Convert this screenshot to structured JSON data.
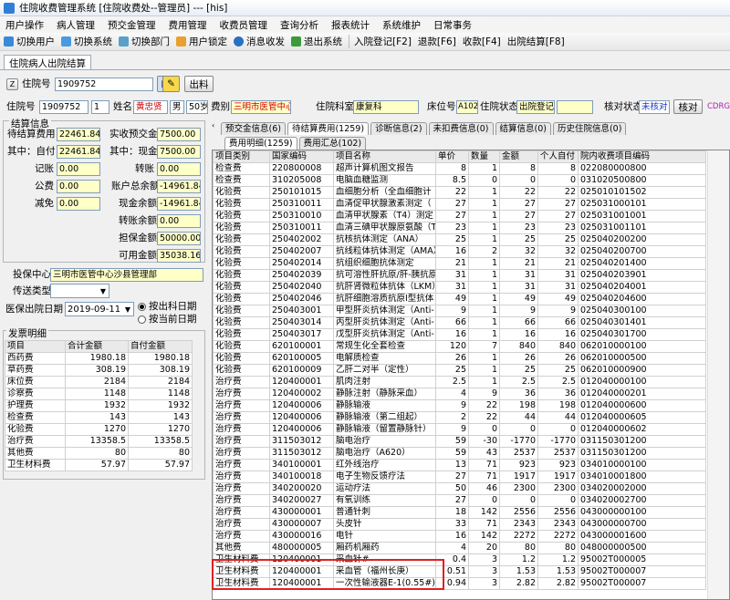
{
  "title": "住院收费管理系统 [住院收费处--管理员] --- [his]",
  "menu": [
    "用户操作",
    "病人管理",
    "预交金管理",
    "费用管理",
    "收费员管理",
    "查询分析",
    "报表统计",
    "系统维护",
    "日常事务"
  ],
  "toolbar": [
    "切换用户",
    "切换系统",
    "切换部门",
    "用户锁定",
    "消息收发",
    "退出系统",
    "入院登记[F2]",
    "退款[F6]",
    "收款[F4]",
    "出院结算[F8]"
  ],
  "doc_tab": "住院病人出院结算",
  "search": {
    "label": "住院号",
    "value": "1909752",
    "btn_print": "出料"
  },
  "patient": {
    "id": "1909752",
    "seq": "1",
    "name_label": "姓名",
    "name": "黄忠贤",
    "sex": "男",
    "age": "50岁",
    "cat_label": "费别",
    "cat": "三明市医管中心",
    "dept_label": "住院科室",
    "dept": "康复科",
    "bed_label": "床位号",
    "bed": "A1028",
    "status_label": "住院状态",
    "status": "出院登记",
    "audit_label": "核对状态",
    "audit": "未核对",
    "audit_btn": "核对",
    "cdrg": "CDRG分"
  },
  "settle": {
    "legend": "结算信息",
    "total_label": "待结算费用",
    "total": "22461.84",
    "prepay_label": "实收预交金",
    "prepay": "7500.00",
    "self_label": "其中：自付",
    "self": "22461.84",
    "cash_label": "其中：现金",
    "cash": "7500.00",
    "credit_label": "记账",
    "credit": "0.00",
    "transfer_label": "转账",
    "transfer": "0.00",
    "pub_label": "公费",
    "pub": "0.00",
    "balance_label": "账户总余额",
    "balance": "-14961.84",
    "reduce_label": "减免",
    "reduce": "0.00",
    "cash_bal_label": "现金余额",
    "cash_bal": "-14961.84",
    "tr_bal_label": "转账余额",
    "tr_bal": "0.00",
    "guar_label": "担保金额",
    "guar": "50000.00",
    "avail_label": "可用金额",
    "avail": "35038.16"
  },
  "insure": {
    "label": "投保中心",
    "value": "三明市医管中心沙县管理部",
    "type_label": "传送类型",
    "type": ""
  },
  "discharge": {
    "label": "医保出院日期",
    "date": "2019-09-11",
    "opt1": "按出科日期",
    "opt2": "按当前日期"
  },
  "invoice": {
    "legend": "发票明细",
    "headers": [
      "项目",
      "合计金额",
      "自付金额"
    ],
    "rows": [
      [
        "西药费",
        "1980.18",
        "1980.18"
      ],
      [
        "草药费",
        "308.19",
        "308.19"
      ],
      [
        "床位费",
        "2184",
        "2184"
      ],
      [
        "诊察费",
        "1148",
        "1148"
      ],
      [
        "护理费",
        "1932",
        "1932"
      ],
      [
        "检查费",
        "143",
        "143"
      ],
      [
        "化验费",
        "1270",
        "1270"
      ],
      [
        "治疗费",
        "13358.5",
        "13358.5"
      ],
      [
        "其他费",
        "80",
        "80"
      ],
      [
        "卫生材料费",
        "57.97",
        "57.97"
      ]
    ]
  },
  "tabs_top": [
    "预交金信息(6)",
    "待结算费用(1259)",
    "诊断信息(2)",
    "未扣费信息(0)",
    "结算信息(0)",
    "历史住院信息(0)"
  ],
  "tabs_sub": [
    "费用明细(1259)",
    "费用汇总(102)"
  ],
  "detail": {
    "headers": [
      "项目类别",
      "国家编码",
      "项目名称",
      "单价",
      "数量",
      "金额",
      "个人自付",
      "院内收费项目编码"
    ],
    "rows": [
      [
        "检查费",
        "220800008",
        "超声计算机图文报告",
        "8",
        "1",
        "8",
        "8",
        "022080000800"
      ],
      [
        "检查费",
        "310205008",
        "电脑血糖监测",
        "8.5",
        "0",
        "0",
        "0",
        "031020500800"
      ],
      [
        "化验费",
        "250101015",
        "血细胞分析（全血细胞计",
        "22",
        "1",
        "22",
        "22",
        "025010101502"
      ],
      [
        "化验费",
        "250310011",
        "血清促甲状腺激素测定（",
        "27",
        "1",
        "27",
        "27",
        "025031000101"
      ],
      [
        "化验费",
        "250310010",
        "血清甲状腺素（T4）测定",
        "27",
        "1",
        "27",
        "27",
        "025031001001"
      ],
      [
        "化验费",
        "250310011",
        "血清三碘甲状腺原氨酸（T3",
        "23",
        "1",
        "23",
        "23",
        "025031001101"
      ],
      [
        "化验费",
        "250402002",
        "抗核抗体测定（ANA）",
        "25",
        "1",
        "25",
        "25",
        "025040200200"
      ],
      [
        "化验费",
        "250402007",
        "抗线粒体抗体测定（AMA）",
        "16",
        "2",
        "32",
        "32",
        "025040200700"
      ],
      [
        "化验费",
        "250402014",
        "抗组织细胞抗体测定",
        "21",
        "1",
        "21",
        "21",
        "025040201400"
      ],
      [
        "化验费",
        "250402039",
        "抗可溶性肝抗原/肝-胰抗原",
        "31",
        "1",
        "31",
        "31",
        "025040203901"
      ],
      [
        "化验费",
        "250402040",
        "抗肝肾微粒体抗体（LKM）",
        "31",
        "1",
        "31",
        "31",
        "025040204001"
      ],
      [
        "化验费",
        "250402046",
        "抗肝细胞溶质抗原I型抗体",
        "49",
        "1",
        "49",
        "49",
        "025040204600"
      ],
      [
        "化验费",
        "250403001",
        "甲型肝炎抗体测定（Anti-",
        "9",
        "1",
        "9",
        "9",
        "025040300100"
      ],
      [
        "化验费",
        "250403014",
        "丙型肝炎抗体测定（Anti-",
        "66",
        "1",
        "66",
        "66",
        "025040301401"
      ],
      [
        "化验费",
        "250403017",
        "戊型肝炎抗体测定（Anti-",
        "16",
        "1",
        "16",
        "16",
        "025040301700"
      ],
      [
        "化验费",
        "620100001",
        "常规生化全套检查",
        "120",
        "7",
        "840",
        "840",
        "062010000100"
      ],
      [
        "化验费",
        "620100005",
        "电解质检查",
        "26",
        "1",
        "26",
        "26",
        "062010000500"
      ],
      [
        "化验费",
        "620100009",
        "乙肝二对半（定性）",
        "25",
        "1",
        "25",
        "25",
        "062010000900"
      ],
      [
        "治疗费",
        "120400001",
        "肌肉注射",
        "2.5",
        "1",
        "2.5",
        "2.5",
        "012040000100"
      ],
      [
        "治疗费",
        "120400002",
        "静脉注射（静脉采血）",
        "4",
        "9",
        "36",
        "36",
        "012040000201"
      ],
      [
        "治疗费",
        "120400006",
        "静脉输液",
        "9",
        "22",
        "198",
        "198",
        "012040000600"
      ],
      [
        "治疗费",
        "120400006",
        "静脉输液（第二组起）",
        "2",
        "22",
        "44",
        "44",
        "012040000605"
      ],
      [
        "治疗费",
        "120400006",
        "静脉输液（留置静脉针）",
        "9",
        "0",
        "0",
        "0",
        "012040000602"
      ],
      [
        "治疗费",
        "311503012",
        "脑电治疗",
        "59",
        "-30",
        "-1770",
        "-1770",
        "031150301200"
      ],
      [
        "治疗费",
        "311503012",
        "脑电治疗（A620）",
        "59",
        "43",
        "2537",
        "2537",
        "031150301200"
      ],
      [
        "治疗费",
        "340100001",
        "红外线治疗",
        "13",
        "71",
        "923",
        "923",
        "034010000100"
      ],
      [
        "治疗费",
        "340100018",
        "电子生物反馈疗法",
        "27",
        "71",
        "1917",
        "1917",
        "034010001800"
      ],
      [
        "治疗费",
        "340200020",
        "运动疗法",
        "50",
        "46",
        "2300",
        "2300",
        "034020002000"
      ],
      [
        "治疗费",
        "340200027",
        "有氧训练",
        "27",
        "0",
        "0",
        "0",
        "034020002700"
      ],
      [
        "治疗费",
        "430000001",
        "普通针刺",
        "18",
        "142",
        "2556",
        "2556",
        "043000000100"
      ],
      [
        "治疗费",
        "430000007",
        "头皮针",
        "33",
        "71",
        "2343",
        "2343",
        "043000000700"
      ],
      [
        "治疗费",
        "430000016",
        "电针",
        "16",
        "142",
        "2272",
        "2272",
        "043000001600"
      ],
      [
        "其他费",
        "480000005",
        "厢药机厢药",
        "4",
        "20",
        "80",
        "80",
        "048000000500"
      ],
      [
        "卫生材料费",
        "120400001",
        "采血针#",
        "0.4",
        "3",
        "1.2",
        "1.2",
        "95002T000005"
      ],
      [
        "卫生材料费",
        "120400001",
        "采血管（福州长庚）",
        "0.51",
        "3",
        "1.53",
        "1.53",
        "95002T000007"
      ],
      [
        "卫生材料费",
        "120400001",
        "一次性输液器E-1(0.55#)",
        "0.94",
        "3",
        "2.82",
        "2.82",
        "95002T000007"
      ]
    ]
  },
  "colors": {
    "highlight_border": "#e02020",
    "field_yellow": "#ffffc8",
    "red_text": "#d00000"
  }
}
